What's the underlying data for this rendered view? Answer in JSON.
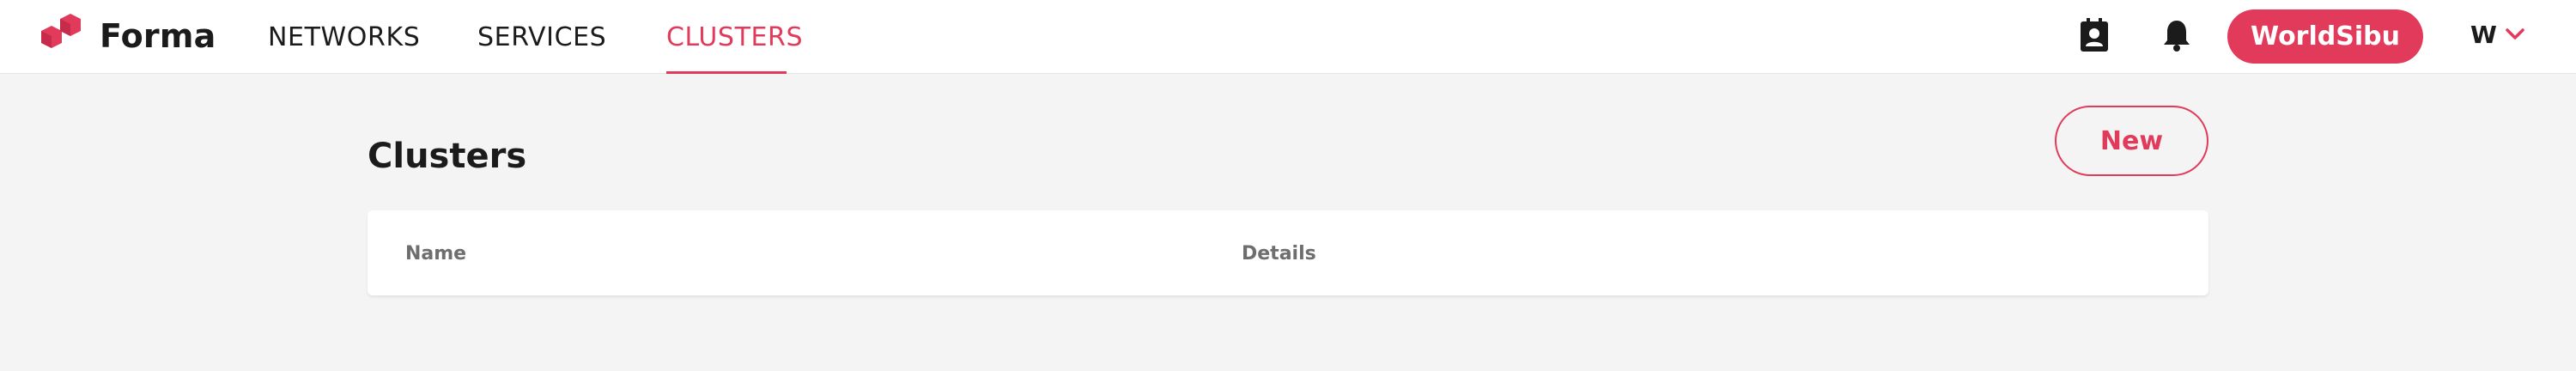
{
  "brand": {
    "name": "Forma",
    "accent_color": "#e23a5a"
  },
  "nav": {
    "items": [
      {
        "label": "NETWORKS",
        "active": false
      },
      {
        "label": "SERVICES",
        "active": false
      },
      {
        "label": "CLUSTERS",
        "active": true
      }
    ]
  },
  "header": {
    "contacts_icon": "contact-card-icon",
    "notifications_icon": "bell-icon",
    "org_label": "WorldSibu",
    "user_initial": "W",
    "user_menu_icon": "chevron-down-icon"
  },
  "main": {
    "title": "Clusters",
    "new_button_label": "New",
    "table": {
      "columns": [
        "Name",
        "Details"
      ],
      "rows": []
    }
  }
}
